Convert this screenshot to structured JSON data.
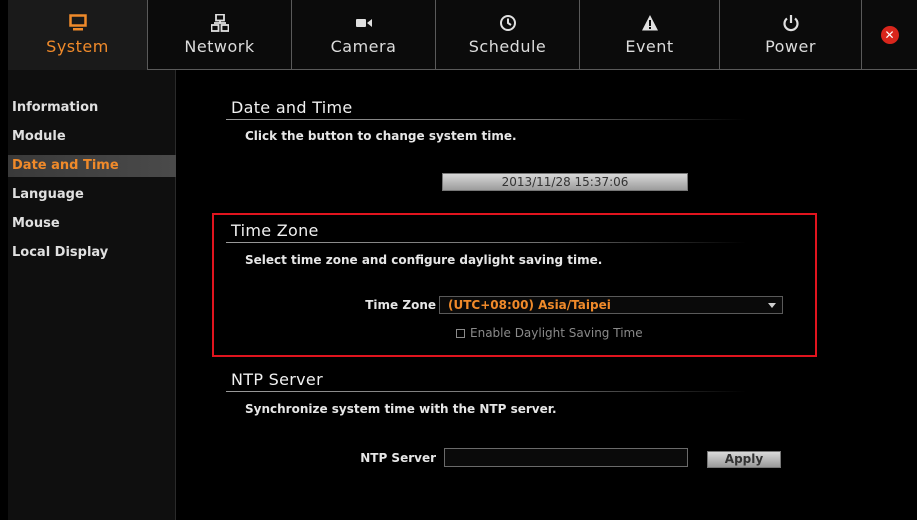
{
  "nav": {
    "tabs": [
      {
        "label": "System",
        "icon": "monitor-icon",
        "active": true
      },
      {
        "label": "Network",
        "icon": "network-icon"
      },
      {
        "label": "Camera",
        "icon": "camera-icon"
      },
      {
        "label": "Schedule",
        "icon": "clock-icon"
      },
      {
        "label": "Event",
        "icon": "warning-icon"
      },
      {
        "label": "Power",
        "icon": "power-icon"
      }
    ],
    "close_icon": "close-icon"
  },
  "sidebar": {
    "items": [
      {
        "label": "Information"
      },
      {
        "label": "Module"
      },
      {
        "label": "Date and Time",
        "active": true
      },
      {
        "label": "Language"
      },
      {
        "label": "Mouse"
      },
      {
        "label": "Local Display"
      }
    ]
  },
  "date_time": {
    "title": "Date and Time",
    "description": "Click the button to change system time.",
    "current_time": "2013/11/28 15:37:06"
  },
  "time_zone": {
    "title": "Time Zone",
    "description": "Select time zone and configure daylight saving time.",
    "field_label": "Time Zone",
    "selected": "(UTC+08:00) Asia/Taipei",
    "dst_label": "Enable Daylight Saving Time",
    "dst_checked": false
  },
  "ntp": {
    "title": "NTP Server",
    "description": "Synchronize system time with the NTP server.",
    "field_label": "NTP Server",
    "value": "",
    "apply_label": "Apply"
  },
  "colors": {
    "accent": "#f08a2a",
    "highlight_border": "#e0141e",
    "background": "#000000"
  }
}
